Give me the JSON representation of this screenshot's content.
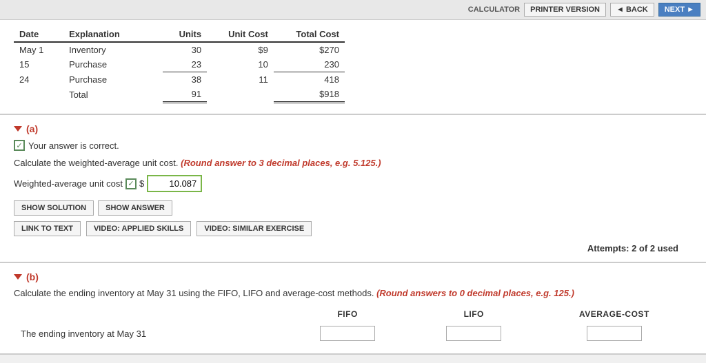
{
  "topbar": {
    "calculator_label": "CALCULATOR",
    "printer_label": "PRINTER VERSION",
    "back_label": "◄ BACK",
    "next_label": "NEXT ►"
  },
  "table": {
    "headers": [
      "Date",
      "Explanation",
      "Units",
      "Unit Cost",
      "Total Cost"
    ],
    "rows": [
      {
        "date": "May 1",
        "explanation": "Inventory",
        "units": "30",
        "unit_cost": "$9",
        "total_cost": "$270"
      },
      {
        "date": "15",
        "explanation": "Purchase",
        "units": "23",
        "unit_cost": "10",
        "total_cost": "230"
      },
      {
        "date": "24",
        "explanation": "Purchase",
        "units": "38",
        "unit_cost": "11",
        "total_cost": "418"
      },
      {
        "date": "",
        "explanation": "Total",
        "units": "91",
        "unit_cost": "",
        "total_cost": "$918"
      }
    ]
  },
  "section_a": {
    "label": "(a)",
    "correct_message": "Your answer is correct.",
    "instruction": "Calculate the weighted-average unit cost.",
    "round_instruction": "(Round answer to 3 decimal places, e.g. 5.125.)",
    "weighted_avg_label": "Weighted-average unit cost",
    "weighted_avg_value": "10.087",
    "show_solution_label": "SHOW SOLUTION",
    "show_answer_label": "SHOW ANSWER",
    "link_to_text_label": "LINK TO TEXT",
    "video_applied_label": "VIDEO: APPLIED SKILLS",
    "video_similar_label": "VIDEO: SIMILAR EXERCISE",
    "attempts_text": "Attempts: 2 of 2 used"
  },
  "section_b": {
    "label": "(b)",
    "instruction": "Calculate the ending inventory at May 31 using the FIFO, LIFO and average-cost methods.",
    "round_instruction": "(Round answers to 0 decimal places, e.g. 125.)",
    "col_fifo": "FIFO",
    "col_lifo": "LIFO",
    "col_avg": "AVERAGE-COST",
    "ending_inventory_label": "The ending inventory at May 31"
  }
}
